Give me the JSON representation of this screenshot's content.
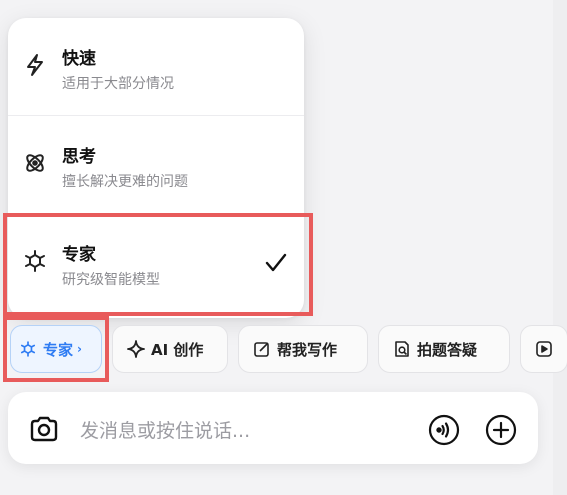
{
  "menu": {
    "items": [
      {
        "title": "快速",
        "desc": "适用于大部分情况",
        "icon": "lightning-icon"
      },
      {
        "title": "思考",
        "desc": "擅长解决更难的问题",
        "icon": "atom-icon"
      },
      {
        "title": "专家",
        "desc": "研究级智能模型",
        "icon": "expert-cube-icon",
        "selected": true
      }
    ]
  },
  "chips": {
    "expert": "专家",
    "ai_create": "AI 创作",
    "help_write": "帮我写作",
    "photo_answer": "拍题答疑"
  },
  "input": {
    "placeholder": "发消息或按住说话..."
  },
  "colors": {
    "accent": "#2f7cf3",
    "highlight": "#e85b5b"
  }
}
